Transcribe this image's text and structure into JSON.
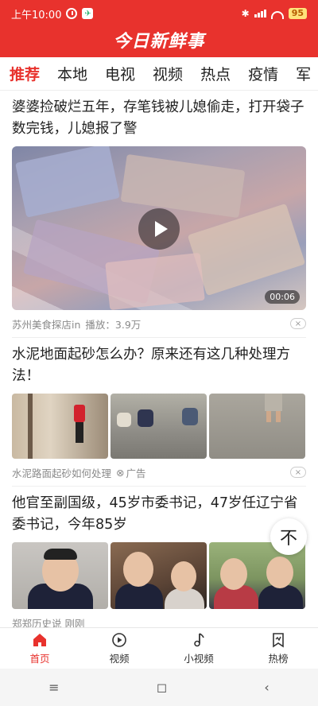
{
  "status_bar": {
    "time": "上午10:00",
    "battery": "95"
  },
  "app": {
    "title": "今日新鲜事",
    "brand_color": "#e8322d"
  },
  "tabs": [
    {
      "label": "推荐",
      "active": true
    },
    {
      "label": "本地"
    },
    {
      "label": "电视"
    },
    {
      "label": "视频"
    },
    {
      "label": "热点"
    },
    {
      "label": "疫情"
    },
    {
      "label": "军"
    }
  ],
  "articles": [
    {
      "title": "婆婆捡破烂五年，存笔钱被儿媳偷走，打开袋子数完钱，儿媳报了警",
      "duration": "00:06",
      "source": "苏州美食探店in",
      "plays": "播放：3.9万",
      "close": "×"
    },
    {
      "title": "水泥地面起砂怎么办？原来还有这几种处理方法！",
      "source": "水泥路面起砂如何处理",
      "ad_label": "广告",
      "close": "×"
    },
    {
      "title": "他官至副国级，45岁市委书记，47岁任辽宁省委书记，今年85岁",
      "source": "郑郑历史说 刚刚"
    }
  ],
  "scroll_top_glyph": "不",
  "bottom_nav": [
    {
      "label": "首页",
      "icon": "home-icon",
      "active": true
    },
    {
      "label": "视频",
      "icon": "play-circle-icon"
    },
    {
      "label": "小视频",
      "icon": "music-note-icon"
    },
    {
      "label": "热榜",
      "icon": "hot-list-icon"
    }
  ],
  "system_nav": {
    "menu": "≡",
    "home": "◻",
    "back": "‹"
  }
}
